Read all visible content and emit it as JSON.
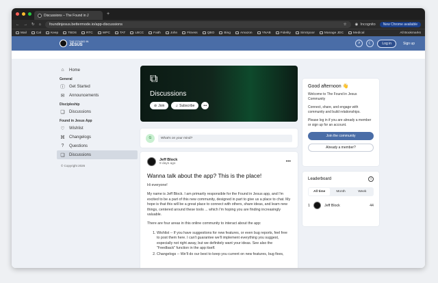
{
  "browser": {
    "tab_title": "Discussions – The Found in J",
    "new_tab": "+",
    "url": "foundinjesus.bettermode.io/app-discussions",
    "incognito": "Incognito",
    "new_chrome": "New Chrome available",
    "bookmarks": [
      "Mail",
      "Cal",
      "Keep",
      "TBDS",
      "RTC",
      "WPC",
      "TAT",
      "LBCC",
      "Faith",
      "John",
      "Fitness",
      "QBO",
      "Bing",
      "Amazon",
      "YNAB",
      "Fidelity",
      "SimSpoor",
      "Manage JDC",
      "Medical"
    ],
    "all_bookmarks": "All Bookmarks"
  },
  "header": {
    "logo_top": "THE FOUND IN",
    "logo_main": "JESUS",
    "login": "Log in",
    "signup": "Sign up"
  },
  "sidebar": {
    "home": "Home",
    "sections": [
      {
        "title": "General",
        "items": [
          "Get Started",
          "Announcements"
        ]
      },
      {
        "title": "Discipleship",
        "items": [
          "Discussions"
        ]
      },
      {
        "title": "Found in Jesus App",
        "items": [
          "Wishlist",
          "Changelogs",
          "Questions",
          "Discussions"
        ]
      }
    ],
    "copyright": "© Copyright 2026"
  },
  "hero": {
    "title": "Discussions",
    "join": "Join",
    "subscribe": "Subscribe",
    "more": "•••"
  },
  "composer": {
    "avatar_initial": "G",
    "placeholder": "What's on your mind?"
  },
  "post": {
    "author": "Jeff Block",
    "time": "9 days ago",
    "more": "•••",
    "title": "Wanna talk about the app? This is the place!",
    "greeting": "Hi everyone!",
    "para1": "My name is Jeff Block. I am primarily responsible for the Found in Jesus app, and I'm excited to be a part of this new community, designed in part to give us a place to chat. My hope is that this will be a great place to connect with others, share ideas, and learn new things, centered around these tools ... which I'm hoping you are finding increasingly valuable.",
    "para2": "There are four areas in this online community to interact about the app:",
    "list": [
      "Wishlist -- If you have suggestions for new features, or even bug reports, feel free to post them here. I can't guarantee we'll implement everything you suggest, especially not right away, but we definitely want your ideas. See also the \"Feedback\" function in the app itself.",
      "Changelogs -- We'll do our best to keep you current on new features, bug fixes,"
    ]
  },
  "welcome": {
    "title": "Good afternoon 👋",
    "p1": "Welcome to The Found in Jesus Community",
    "p2": "Connect, share, and engage with community and build relationships.",
    "p3": "Please log in if you are already a member or sign up for an account.",
    "join": "Join the community",
    "member": "Already a member?"
  },
  "leaderboard": {
    "title": "Leaderboard",
    "tabs": [
      "All time",
      "Month",
      "Week"
    ],
    "rows": [
      {
        "rank": "1",
        "name": "Jeff Block",
        "points": "44"
      }
    ]
  }
}
